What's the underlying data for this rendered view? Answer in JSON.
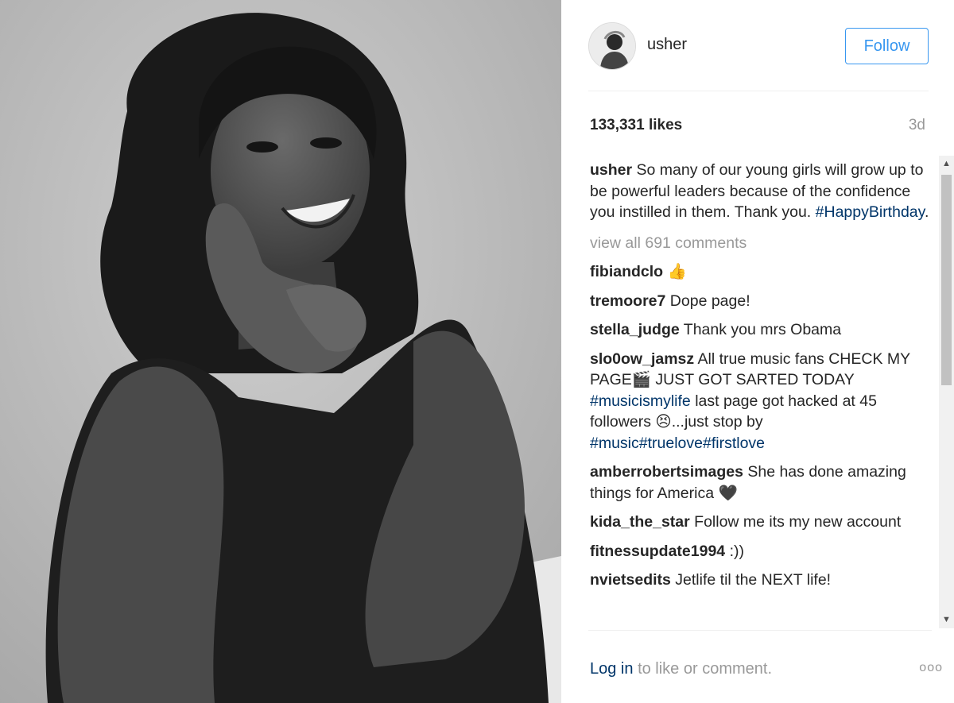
{
  "post": {
    "username": "usher",
    "follow_label": "Follow",
    "likes": "133,331 likes",
    "time_ago": "3d"
  },
  "caption": {
    "username": "usher",
    "text": "So many of our young girls will grow up to be powerful leaders because of the confidence you instilled in them. Thank you.",
    "hashtag": "#HappyBirthday",
    "after": "."
  },
  "view_all": "view all 691 comments",
  "comments": [
    {
      "user": "fibiandclo",
      "parts": [
        {
          "t": "text",
          "v": "👍"
        }
      ]
    },
    {
      "user": "tremoore7",
      "parts": [
        {
          "t": "text",
          "v": "Dope page!"
        }
      ]
    },
    {
      "user": "stella_judge",
      "parts": [
        {
          "t": "text",
          "v": "Thank you mrs Obama"
        }
      ]
    },
    {
      "user": "slo0ow_jamsz",
      "parts": [
        {
          "t": "text",
          "v": "All true music fans CHECK MY PAGE🎬 JUST GOT SARTED TODAY "
        },
        {
          "t": "tag",
          "v": "#musicismylife"
        },
        {
          "t": "text",
          "v": " last page got hacked at 45 followers 😣...just stop by "
        },
        {
          "t": "tag",
          "v": "#music#truelove#firstlove"
        }
      ]
    },
    {
      "user": "amberrobertsimages",
      "parts": [
        {
          "t": "text",
          "v": "She has done amazing things for America 🖤"
        }
      ]
    },
    {
      "user": "kida_the_star",
      "parts": [
        {
          "t": "text",
          "v": "Follow me its my new account"
        }
      ]
    },
    {
      "user": "fitnessupdate1994",
      "parts": [
        {
          "t": "text",
          "v": ":))"
        }
      ]
    },
    {
      "user": "nvietsedits",
      "parts": [
        {
          "t": "text",
          "v": "Jetlife til the NEXT life!"
        }
      ]
    }
  ],
  "footer": {
    "login": "Log in",
    "rest": "to like or comment.",
    "more_icon": "ooo"
  },
  "icons": {
    "scroll_up": "▲",
    "scroll_down": "▼"
  },
  "colors": {
    "accent": "#3897f0",
    "hashtag": "#003569",
    "muted": "#999999"
  }
}
